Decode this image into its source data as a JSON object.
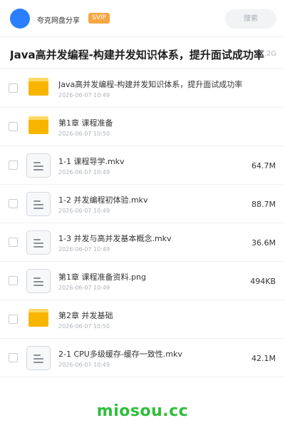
{
  "header": {
    "share_name": "夸克网盘分享",
    "badge": "SVIP",
    "search_placeholder": "搜索"
  },
  "folder": {
    "title": "Java高并发编程-构建并发知识体系，提升面试成功率",
    "total_size": "7.2G"
  },
  "files": [
    {
      "type": "folder",
      "name": "Java高并发编程-构建并发知识体系，提升面试成功率",
      "date": "2026-06-07 10:49",
      "size": ""
    },
    {
      "type": "folder",
      "name": "第1章 课程准备",
      "date": "2026-06-07 10:50",
      "size": ""
    },
    {
      "type": "file",
      "name": "1-1 课程导学.mkv",
      "date": "2026-06-07 10:49",
      "size": "64.7M"
    },
    {
      "type": "file",
      "name": "1-2 并发编程初体验.mkv",
      "date": "2026-06-07 10:49",
      "size": "88.7M"
    },
    {
      "type": "file",
      "name": "1-3 并发与高并发基本概念.mkv",
      "date": "2026-06-07 10:49",
      "size": "36.6M"
    },
    {
      "type": "file",
      "name": "第1章 课程准备资料.png",
      "date": "2026-06-07 10:49",
      "size": "494KB"
    },
    {
      "type": "folder",
      "name": "第2章 并发基础",
      "date": "2026-06-07 10:50",
      "size": ""
    },
    {
      "type": "file",
      "name": "2-1 CPU多级缓存-缓存一致性.mkv",
      "date": "2026-06-07 10:49",
      "size": "42.1M"
    }
  ],
  "watermark": "miosou.cc",
  "colors": {
    "avatar": "#2b7fff",
    "badge": "#f4a742",
    "folder": "#f7b500",
    "watermark": "#2fbf3a"
  }
}
